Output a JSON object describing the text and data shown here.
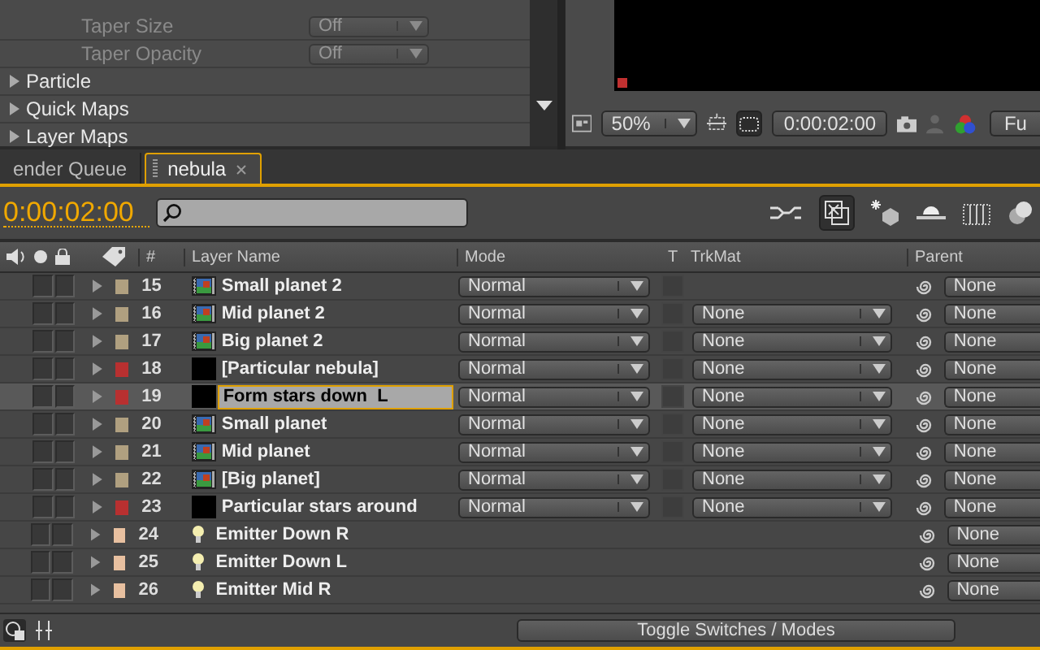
{
  "effect_controls": {
    "properties": [
      {
        "label": "Taper Size",
        "value": "Off"
      },
      {
        "label": "Taper Opacity",
        "value": "Off"
      }
    ],
    "groups": [
      {
        "label": "Particle",
        "expanded": false
      },
      {
        "label": "Quick Maps",
        "expanded": false
      },
      {
        "label": "Layer Maps",
        "expanded": false
      }
    ]
  },
  "viewer": {
    "zoom": "50%",
    "timecode": "0:00:02:00",
    "view_mode": "Fu"
  },
  "tabs": [
    {
      "label": "ender Queue",
      "selected": false,
      "closable": false
    },
    {
      "label": "nebula",
      "selected": true,
      "closable": true
    }
  ],
  "timeline": {
    "timecode": "0:00:02:00",
    "columns": [
      "#",
      "Layer Name",
      "Mode",
      "T",
      "TrkMat",
      "Parent"
    ],
    "rows": [
      {
        "number": "15",
        "name": "Small planet 2",
        "kind": "footage",
        "color": "#b0a080",
        "mode": "Normal",
        "parent": "None",
        "selected": false
      },
      {
        "number": "16",
        "name": "Mid planet 2",
        "kind": "footage",
        "color": "#b0a080",
        "mode": "Normal",
        "trkmat": "None",
        "parent": "None",
        "selected": false
      },
      {
        "number": "17",
        "name": "Big planet 2",
        "kind": "footage",
        "color": "#b0a080",
        "mode": "Normal",
        "trkmat": "None",
        "parent": "None",
        "selected": false
      },
      {
        "number": "18",
        "name": "[Particular nebula]",
        "kind": "solid",
        "color": "#b83030",
        "mode": "Normal",
        "trkmat": "None",
        "parent": "None",
        "selected": false
      },
      {
        "number": "19",
        "name": "Form stars down  L",
        "kind": "solid",
        "color": "#b83030",
        "mode": "Normal",
        "trkmat": "None",
        "parent": "None",
        "selected": true
      },
      {
        "number": "20",
        "name": "Small planet",
        "kind": "footage",
        "color": "#b0a080",
        "mode": "Normal",
        "trkmat": "None",
        "parent": "None",
        "selected": false
      },
      {
        "number": "21",
        "name": "Mid planet",
        "kind": "footage",
        "color": "#b0a080",
        "mode": "Normal",
        "trkmat": "None",
        "parent": "None",
        "selected": false
      },
      {
        "number": "22",
        "name": "[Big planet]",
        "kind": "footage",
        "color": "#b0a080",
        "mode": "Normal",
        "trkmat": "None",
        "parent": "None",
        "selected": false
      },
      {
        "number": "23",
        "name": "Particular stars around",
        "kind": "solid",
        "color": "#b83030",
        "mode": "Normal",
        "trkmat": "None",
        "parent": "None",
        "selected": false
      },
      {
        "number": "24",
        "name": "Emitter Down R",
        "kind": "light",
        "color": "#e8c0a0",
        "parent": "None",
        "selected": false
      },
      {
        "number": "25",
        "name": "Emitter Down L",
        "kind": "light",
        "color": "#e8c0a0",
        "parent": "None",
        "selected": false
      },
      {
        "number": "26",
        "name": "Emitter Mid R",
        "kind": "light",
        "color": "#e8c0a0",
        "parent": "None",
        "selected": false
      }
    ],
    "footer_button": "Toggle Switches / Modes"
  }
}
